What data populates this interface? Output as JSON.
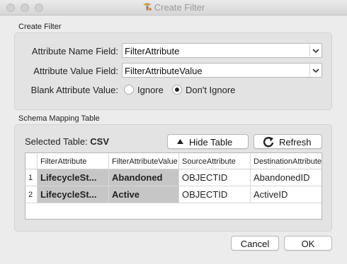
{
  "window": {
    "title": "Create Filter"
  },
  "create_filter": {
    "section_label": "Create Filter",
    "attribute_name": {
      "label": "Attribute Name Field:",
      "value": "FilterAttribute"
    },
    "attribute_value": {
      "label": "Attribute Value Field:",
      "value": "FilterAttributeValue"
    },
    "blank_value": {
      "label": "Blank Attribute Value:",
      "options": [
        "Ignore",
        "Don't Ignore"
      ],
      "selected": "Don't Ignore"
    }
  },
  "schema": {
    "section_label": "Schema Mapping Table",
    "selected_table_label": "Selected Table:",
    "selected_table_value": "CSV",
    "hide_table_label": "Hide Table",
    "refresh_label": "Refresh",
    "columns": [
      "FilterAttribute",
      "FilterAttributeValue",
      "SourceAttribute",
      "DestinationAttribute"
    ],
    "rows": [
      {
        "num": "1",
        "cells": [
          "LifecycleSt...",
          "Abandoned",
          "OBJECTID",
          "AbandonedID"
        ]
      },
      {
        "num": "2",
        "cells": [
          "LifecycleSt...",
          "Active",
          "OBJECTID",
          "ActiveID"
        ]
      }
    ]
  },
  "footer": {
    "cancel_label": "Cancel",
    "ok_label": "OK"
  }
}
